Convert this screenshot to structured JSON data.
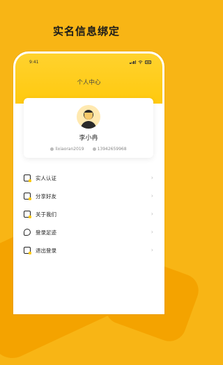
{
  "promo": {
    "title": "实名信息绑定"
  },
  "status_bar": {
    "time": "9:41"
  },
  "header": {
    "title": "个人中心"
  },
  "profile": {
    "name": "李小冉",
    "username": "lixiaoran2019",
    "phone": "13942659968"
  },
  "menu": {
    "items": [
      {
        "label": "实人认证",
        "icon": "shield-icon"
      },
      {
        "label": "分享好友",
        "icon": "share-icon"
      },
      {
        "label": "关于我们",
        "icon": "info-icon"
      },
      {
        "label": "登录足迹",
        "icon": "footprint-icon"
      },
      {
        "label": "退出登录",
        "icon": "logout-icon"
      }
    ]
  },
  "colors": {
    "accent": "#F8B515",
    "header": "#FFC90E"
  }
}
